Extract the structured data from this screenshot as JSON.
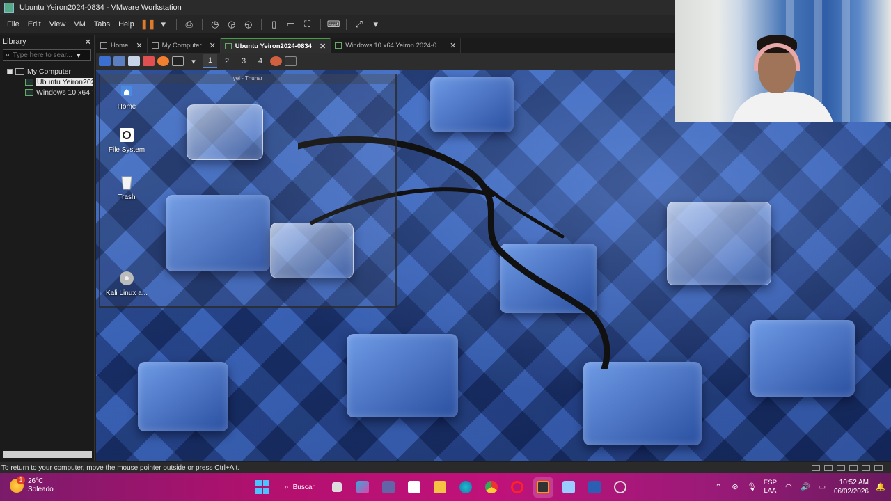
{
  "window": {
    "title": "Ubuntu Yeiron2024-0834 - VMware Workstation"
  },
  "menu": [
    "File",
    "Edit",
    "View",
    "VM",
    "Tabs",
    "Help"
  ],
  "library": {
    "title": "Library",
    "search_placeholder": "Type here to sear...",
    "tree": {
      "root": "My Computer",
      "items": [
        "Ubuntu Yeiron202",
        "Windows 10 x64 Y"
      ]
    }
  },
  "tabs": [
    {
      "label": "Home",
      "icon": "home-icon"
    },
    {
      "label": "My Computer",
      "icon": "computer-icon"
    },
    {
      "label": "Ubuntu Yeiron2024-0834",
      "icon": "vm-icon",
      "active": true
    },
    {
      "label": "Windows 10 x64 Yeiron 2024-0...",
      "icon": "vm-icon"
    }
  ],
  "guest_panel": {
    "workspaces": [
      "1",
      "2",
      "3",
      "4"
    ],
    "active_workspace": "1"
  },
  "desktop": {
    "thunar_title": "yei - Thunar",
    "icons": [
      "Home",
      "File System",
      "Trash",
      "Kali Linux a..."
    ]
  },
  "status_bar": {
    "message": "To return to your computer, move the mouse pointer outside or press Ctrl+Alt."
  },
  "taskbar": {
    "weather": {
      "temp": "26°C",
      "condition": "Soleado",
      "badge": "1"
    },
    "search_label": "Buscar",
    "lang": {
      "line1": "ESP",
      "line2": "LAA"
    },
    "clock": {
      "time": "10:52 AM",
      "date": "06/02/2026"
    }
  },
  "colors": {
    "accent_green": "#3fa23f",
    "taskbar_magenta": "#c0127a",
    "pause_orange": "#e07a2a"
  }
}
